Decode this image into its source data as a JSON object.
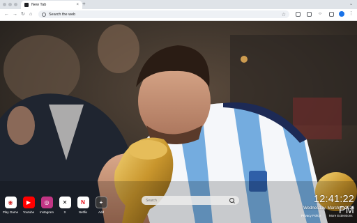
{
  "browser": {
    "tab_title": "New Tab",
    "tab_close": "×",
    "new_tab_icon": "+",
    "omnibox_placeholder": "Search the web",
    "back_glyph": "←",
    "forward_glyph": "→",
    "reload_glyph": "↻",
    "home_glyph": "⌂",
    "star_glyph": "☆",
    "kebab_glyph": "⋮"
  },
  "shortcuts": [
    {
      "label": "Play Game",
      "icon": "play-game-icon",
      "glyph": "◉",
      "color": "#d22a2a"
    },
    {
      "label": "Youtube",
      "icon": "youtube-icon",
      "glyph": "▶",
      "color": "#ff0000"
    },
    {
      "label": "Instagram",
      "icon": "instagram-icon",
      "glyph": "◎",
      "color": "#c13584"
    },
    {
      "label": "X",
      "icon": "x-icon",
      "glyph": "✕",
      "color": "#ffffff"
    },
    {
      "label": "Netflix",
      "icon": "netflix-icon",
      "glyph": "N",
      "color": "#e50914"
    },
    {
      "label": "Add",
      "icon": "add-icon",
      "glyph": "+",
      "color": "#3a3a3a"
    }
  ],
  "search": {
    "placeholder": "Search"
  },
  "clock": {
    "time": "12:41:22 PM",
    "date": "Wednesday, March 4, 2026"
  },
  "footer": {
    "privacy": "Privacy Policy",
    "more": "More Extensions"
  },
  "colors": {
    "jersey_blue": "#74acdf",
    "trophy_gold": "#c9a13b"
  }
}
